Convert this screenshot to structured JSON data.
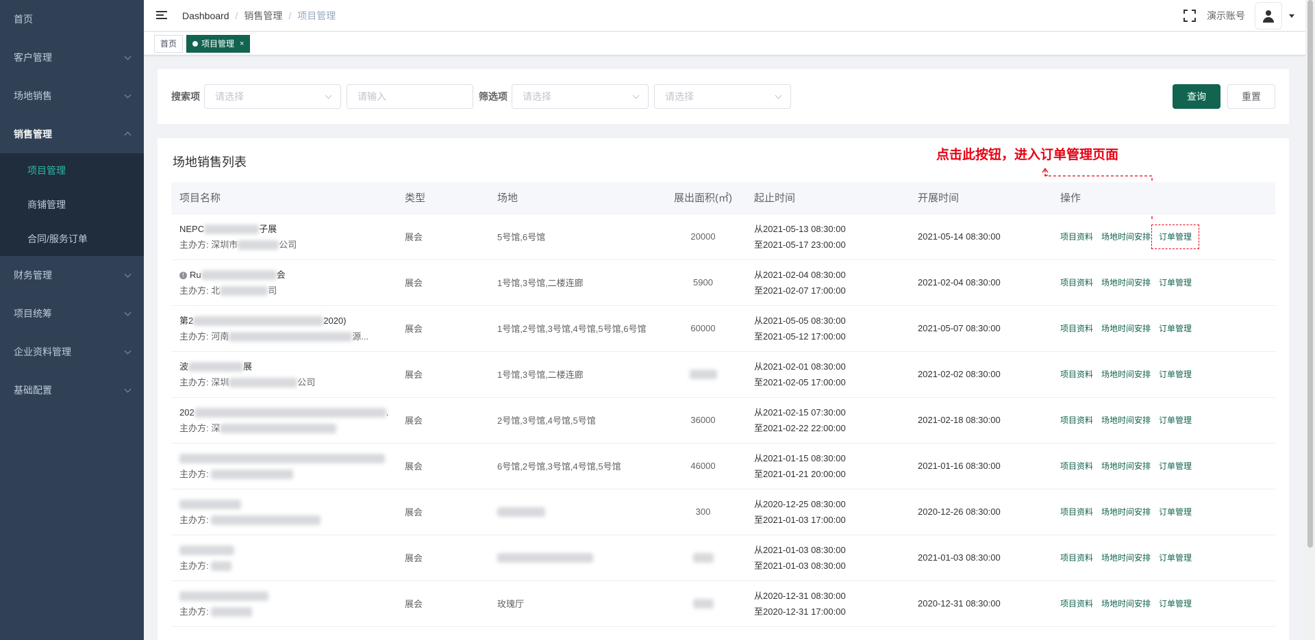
{
  "sidebar": {
    "items": [
      {
        "label": "首页",
        "expandable": false
      },
      {
        "label": "客户管理",
        "expandable": true
      },
      {
        "label": "场地销售",
        "expandable": true
      },
      {
        "label": "销售管理",
        "expandable": true,
        "open": true
      },
      {
        "label": "财务管理",
        "expandable": true
      },
      {
        "label": "项目统筹",
        "expandable": true
      },
      {
        "label": "企业资料管理",
        "expandable": true
      },
      {
        "label": "基础配置",
        "expandable": true
      }
    ],
    "submenu": [
      {
        "label": "项目管理",
        "active": true
      },
      {
        "label": "商铺管理"
      },
      {
        "label": "合同/服务订单"
      }
    ]
  },
  "navbar": {
    "breadcrumb": [
      "Dashboard",
      "销售管理",
      "项目管理"
    ],
    "account": "演示账号"
  },
  "tags": [
    {
      "label": "首页",
      "active": false
    },
    {
      "label": "项目管理",
      "active": true,
      "close": "×"
    }
  ],
  "search": {
    "search_label": "搜索项",
    "search_select_placeholder": "请选择",
    "search_input_placeholder": "请输入",
    "filter_label": "筛选项",
    "filter_select1_placeholder": "请选择",
    "filter_select2_placeholder": "请选择",
    "query_button": "查询",
    "reset_button": "重置"
  },
  "table": {
    "title": "场地销售列表",
    "annotation": "点击此按钮，进入订单管理页面",
    "headers": [
      "项目名称",
      "类型",
      "场地",
      "展出面积(㎡)",
      "起止时间",
      "开展时间",
      "操作"
    ],
    "sponsor_prefix": "主办方: ",
    "actions": [
      "项目资料",
      "场地时间安排",
      "订单管理"
    ],
    "rows": [
      {
        "name_start": "NEPC",
        "name_end": "子展",
        "sponsor_start": "深圳市",
        "sponsor_end": "公司",
        "type": "展会",
        "venue": "5号馆,6号馆",
        "area": "20000",
        "start": "从2021-05-13 08:30:00",
        "end": "至2021-05-17 23:00:00",
        "open": "2021-05-14 08:30:00"
      },
      {
        "name_start": "Ru",
        "name_end": "会",
        "sponsor_start": "北",
        "sponsor_end": "司",
        "type": "展会",
        "venue": "1号馆,3号馆,二楼连廊",
        "area": "5900",
        "start": "从2021-02-04 08:30:00",
        "end": "至2021-02-07 17:00:00",
        "open": "2021-02-04 08:30:00",
        "warn": true
      },
      {
        "name_start": "第2",
        "name_end": "2020)",
        "sponsor_start": "河南",
        "sponsor_end": "源...",
        "type": "展会",
        "venue": "1号馆,2号馆,3号馆,4号馆,5号馆,6号馆",
        "area": "60000",
        "start": "从2021-05-05 08:30:00",
        "end": "至2021-05-12 17:00:00",
        "open": "2021-05-07 08:30:00"
      },
      {
        "name_start": "波",
        "name_end": "展",
        "sponsor_start": "深圳",
        "sponsor_end": "公司",
        "type": "展会",
        "venue": "1号馆,3号馆,二楼连廊",
        "area": "",
        "start": "从2021-02-01 08:30:00",
        "end": "至2021-02-05 17:00:00",
        "open": "2021-02-02 08:30:00"
      },
      {
        "name_start": "202",
        "name_end": ".",
        "sponsor_start": "深",
        "sponsor_end": "",
        "type": "展会",
        "venue": "2号馆,3号馆,4号馆,5号馆",
        "area": "36000",
        "start": "从2021-02-15 07:30:00",
        "end": "至2021-02-22 22:00:00",
        "open": "2021-02-18 08:30:00"
      },
      {
        "name_start": "",
        "name_end": "",
        "sponsor_start": "",
        "sponsor_end": "",
        "type": "展会",
        "venue": "6号馆,2号馆,3号馆,4号馆,5号馆",
        "area": "46000",
        "start": "从2021-01-15 08:30:00",
        "end": "至2021-01-21 20:00:00",
        "open": "2021-01-16 08:30:00"
      },
      {
        "name_start": "",
        "name_end": "",
        "sponsor_start": "",
        "sponsor_end": "",
        "type": "展会",
        "venue": "",
        "area": "300",
        "start": "从2020-12-25 08:30:00",
        "end": "至2021-01-03 17:00:00",
        "open": "2020-12-26 08:30:00"
      },
      {
        "name_start": "",
        "name_end": "",
        "sponsor_start": "",
        "sponsor_end": "",
        "type": "展会",
        "venue": "",
        "area": "",
        "start": "从2021-01-03 08:30:00",
        "end": "至2021-01-03 08:30:00",
        "open": "2021-01-03 08:30:00"
      },
      {
        "name_start": "",
        "name_end": "",
        "sponsor_start": "",
        "sponsor_end": "",
        "type": "展会",
        "venue": "玫瑰厅",
        "area": "",
        "start": "从2020-12-31 08:30:00",
        "end": "至2020-12-31 17:00:00",
        "open": "2020-12-31 08:30:00"
      }
    ]
  },
  "colors": {
    "sidebar_bg": "#304156",
    "primary": "#12634f",
    "annotation": "#e60012"
  }
}
